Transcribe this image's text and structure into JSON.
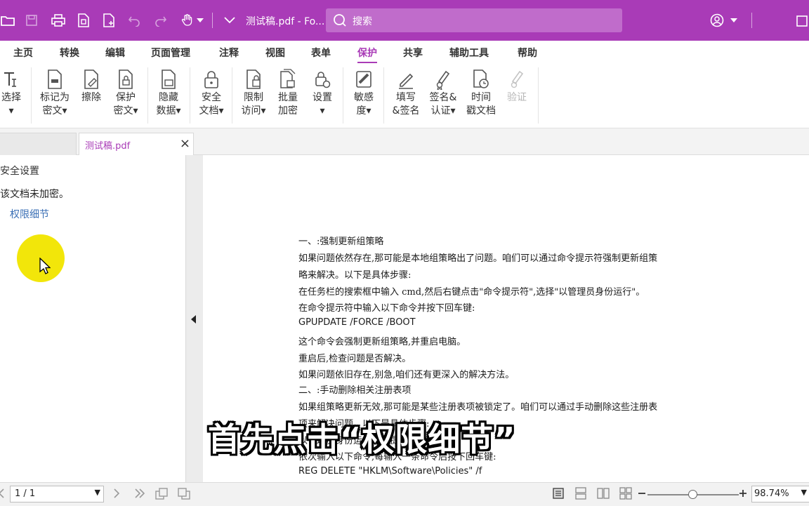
{
  "titlebar": {
    "doc_title": "测试稿.pdf - Fo...",
    "search_placeholder": "搜索"
  },
  "menu": {
    "tabs": [
      "主页",
      "转换",
      "编辑",
      "页面管理",
      "注释",
      "视图",
      "表单",
      "保护",
      "共享",
      "辅助工具",
      "帮助"
    ],
    "active": "保护"
  },
  "ribbon": {
    "select": {
      "line1": "选择",
      "line2": "▾"
    },
    "mark_redact": {
      "line1": "标记为",
      "line2": "密文▾"
    },
    "erase": {
      "line1": "擦除",
      "line2": ""
    },
    "protect_redact": {
      "line1": "保护",
      "line2": "密文▾"
    },
    "hide_data": {
      "line1": "隐藏",
      "line2": "数据▾"
    },
    "secure_doc": {
      "line1": "安全",
      "line2": "文档▾"
    },
    "restrict_access": {
      "line1": "限制",
      "line2": "访问▾"
    },
    "batch_encrypt": {
      "line1": "批量",
      "line2": "加密"
    },
    "settings": {
      "line1": "设置",
      "line2": "▾"
    },
    "sensitivity": {
      "line1": "敏感",
      "line2": "度▾"
    },
    "fill_sign": {
      "line1": "填写",
      "line2": "&签名"
    },
    "sign_certify": {
      "line1": "签名&",
      "line2": "认证▾"
    },
    "timestamp": {
      "line1": "时间",
      "line2": "戳文档"
    },
    "verify": {
      "line1": "验证",
      "line2": ""
    }
  },
  "file_tab": {
    "name": "测试稿.pdf",
    "close": "×"
  },
  "left_panel": {
    "title": "安全设置",
    "status_text": "该文档未加密。",
    "link": "权限细节"
  },
  "document": {
    "lines": [
      "一、:强制更新组策略",
      "如果问题依然存在,那可能是本地组策略出了问题。咱们可以通过命令提示符强制更新组策",
      "略来解决。以下是具体步骤:",
      "在任务栏的搜索框中输入  cmd,然后右键点击\"命令提示符\",选择\"以管理员身份运行\"。",
      "在命令提示符中输入以下命令并按下回车键:",
      "GPUPDATE /FORCE /BOOT",
      "这个命令会强制更新组策略,并重启电脑。",
      "重启后,检查问题是否解决。",
      "如果问题依旧存在,别急,咱们还有更深入的解决方法。",
      "二、:手动删除相关注册表项",
      "如果组策略更新无效,那可能是某些注册表项被锁定了。咱们可以通过手动删除这些注册表",
      "项来解决问题。以下是具体步骤:",
      "以管理员身份运行命令提示符。",
      "依次输入以下命令,每输入一条命令后按下回车键:",
      "REG DELETE \"HKLM\\Software\\Policies\" /f"
    ]
  },
  "subtitle": "首先点击“权限细节”",
  "statusbar": {
    "page": "1 / 1",
    "zoom": "98.74%",
    "zoom_level_percent": 50
  },
  "colors": {
    "accent": "#a93bb7",
    "highlight": "#f2e60a",
    "link": "#3a6fb5"
  }
}
